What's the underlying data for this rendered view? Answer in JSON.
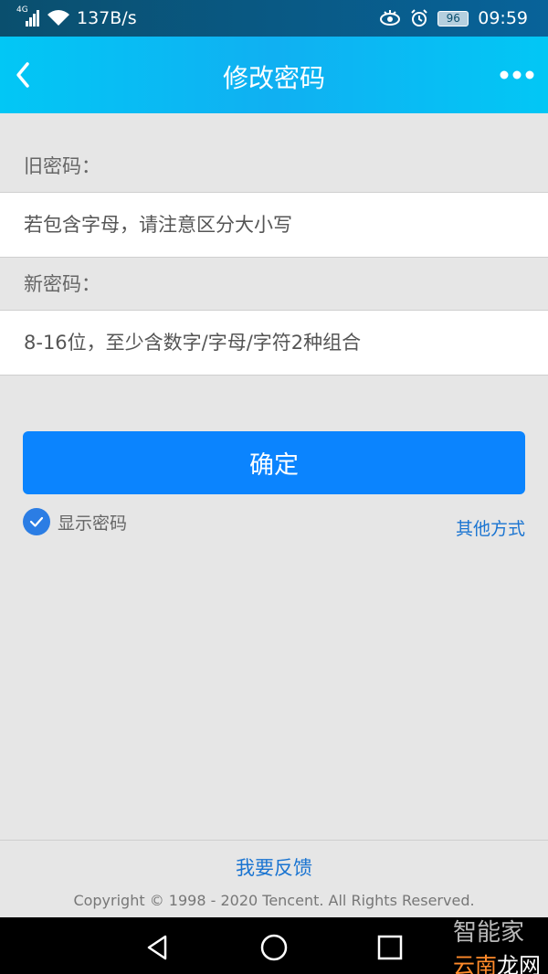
{
  "status_bar": {
    "network_type": "4G",
    "speed": "137B/s",
    "battery": "96",
    "time": "09:59"
  },
  "header": {
    "title": "修改密码"
  },
  "form": {
    "old_password_label": "旧密码：",
    "old_password_placeholder": "若包含字母，请注意区分大小写",
    "new_password_label": "新密码：",
    "new_password_placeholder": "8-16位，至少含数字/字母/字符2种组合"
  },
  "actions": {
    "confirm_label": "确定",
    "show_password_label": "显示密码",
    "show_password_checked": true,
    "other_methods_label": "其他方式"
  },
  "footer": {
    "feedback_label": "我要反馈",
    "copyright": "Copyright © 1998 - 2020 Tencent. All Rights Reserved."
  },
  "watermark": {
    "line1": "智能家",
    "line2_red": "云南",
    "line2_rest": "龙网"
  },
  "colors": {
    "header_gradient": "#02c7f5",
    "primary_button": "#0b84fe",
    "link": "#1a74d1",
    "background": "#e6e6e6"
  }
}
